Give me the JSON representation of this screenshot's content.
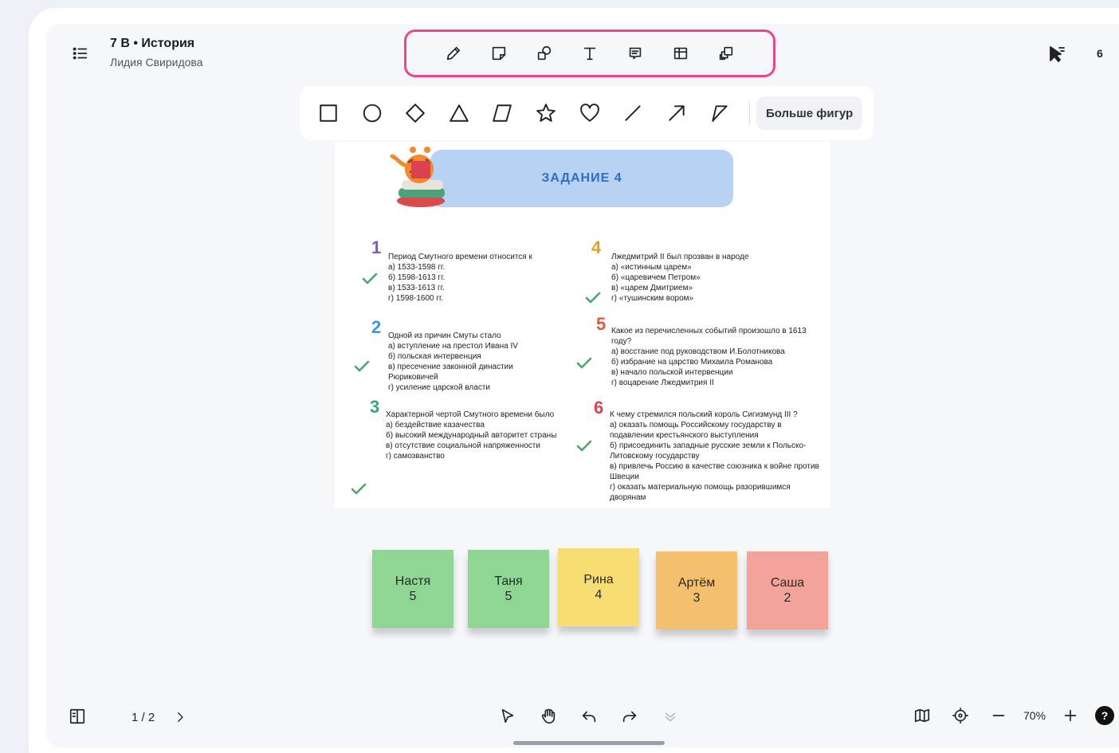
{
  "board": {
    "title": "7 В • История",
    "owner": "Лидия Свиридова",
    "participants": "6"
  },
  "toolbar": {
    "tools": [
      "pencil-icon",
      "sticky-note-icon",
      "shapes-icon",
      "text-icon",
      "comment-icon",
      "table-icon",
      "templates-icon"
    ]
  },
  "shapes": {
    "items": [
      "square-icon",
      "circle-icon",
      "diamond-icon",
      "triangle-icon",
      "parallelogram-icon",
      "star-icon",
      "heart-icon",
      "line-icon",
      "arrow-icon",
      "connector-icon"
    ],
    "more_label": "Больше фигур"
  },
  "task": {
    "title": "ЗАДАНИЕ 4",
    "questions": [
      {
        "num": "1",
        "color": "#7a5bc6",
        "text": "Период Смутного времени относится к",
        "options": [
          "а) 1533-1598 гг.",
          "б) 1598-1613 гг.",
          "в) 1533-1613 гг.",
          "г) 1598-1600 гг."
        ]
      },
      {
        "num": "2",
        "color": "#3a9ad9",
        "text": "Одной из причин Смуты стало",
        "options": [
          "а) вступление на престол Ивана IV",
          "б) польская интервенция",
          "в) пресечение законной династии Рюриковичей",
          "г) усиление царской власти"
        ]
      },
      {
        "num": "3",
        "color": "#3aa37a",
        "text": "Характерной чертой Смутного времени было",
        "options": [
          "а) бездействие казачества",
          "б) высокий международный авторитет страны",
          "в) отсутствие социальной напряженности",
          "г) самозванство"
        ]
      },
      {
        "num": "4",
        "color": "#e0a22a",
        "text": "Лжедмитрий II был прозван в народе",
        "options": [
          "а) «истинным царем»",
          "б) «царевичем Петром»",
          "в) «царем Дмитрием»",
          "г) «тушинским вором»"
        ]
      },
      {
        "num": "5",
        "color": "#e4553a",
        "text": "Какое из перечисленных событий произошло в 1613 году?",
        "options": [
          "а) восстание под руководством И.Болотникова",
          "б) избрание на царство Михаила Романова",
          "в) начало польской интервенции",
          "г) воцарение Лжедмитрия II"
        ]
      },
      {
        "num": "6",
        "color": "#d9434f",
        "text": "К чему стремился польский король Сигизмунд III ?",
        "options": [
          "а) оказать помощь Российскому государству в подавлении крестьянского выступления",
          "б) присоединить западные русские земли к Польско-Литовскому государству",
          "в) привлечь Россию в качестве союзника к войне против Швеции",
          "г) оказать материальную помощь разорившимся дворянам"
        ]
      }
    ]
  },
  "stickies": [
    {
      "name": "Настя",
      "score": "5",
      "color": "#8fd694"
    },
    {
      "name": "Таня",
      "score": "5",
      "color": "#8fd694"
    },
    {
      "name": "Рина",
      "score": "4",
      "color": "#f7dd72"
    },
    {
      "name": "Артём",
      "score": "3",
      "color": "#f5c06e"
    },
    {
      "name": "Саша",
      "score": "2",
      "color": "#f4a39a"
    }
  ],
  "pagination": {
    "current": "1 / 2"
  },
  "zoom": {
    "value": "70%"
  },
  "help": {
    "label": "?"
  }
}
